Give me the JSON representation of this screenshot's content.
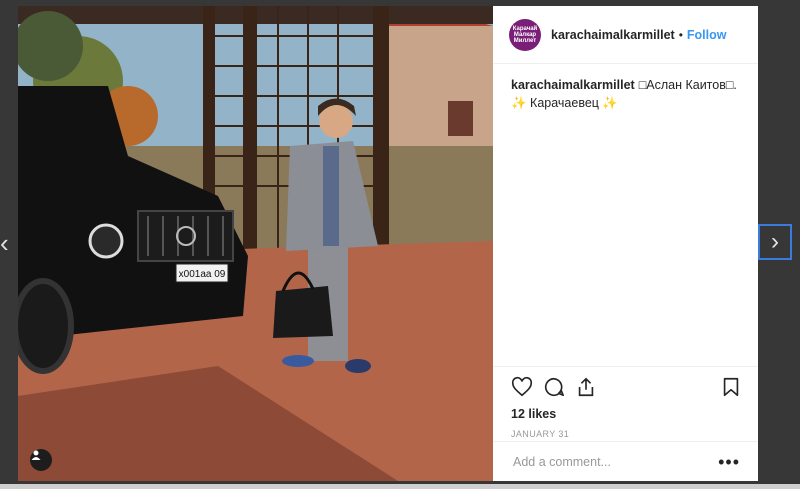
{
  "post": {
    "username": "karachaimalkarmillet",
    "dot": "•",
    "follow_label": "Follow",
    "avatar_text": "Карачай Малкар Миллет",
    "caption_user": "karachaimalkarmillet",
    "caption_text": "□Аслан Каитов□.",
    "caption_line2": "✨ Карачаевец ✨",
    "likes": "12 likes",
    "date": "JANUARY 31",
    "comment_placeholder": "Add a comment...",
    "more_label": "•••",
    "plate": "х001аа 09"
  },
  "nav": {
    "prev": "‹",
    "next": "›"
  },
  "icons": [
    "heart-icon",
    "comment-icon",
    "share-icon",
    "bookmark-icon",
    "user-tag-icon"
  ],
  "colors": {
    "follow": "#3897f0",
    "avatar": "#7a1f78",
    "focus": "#3b7be0"
  }
}
